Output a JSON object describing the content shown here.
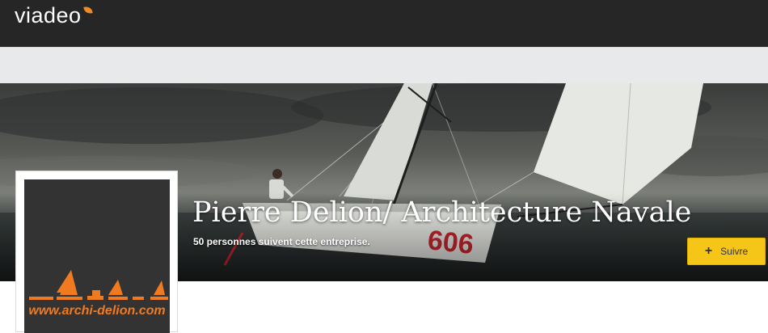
{
  "header": {
    "logo_text": "viadeo",
    "logo_accent_color": "#f08a24",
    "background_color": "#262626"
  },
  "cover": {
    "image_description_icon": "sailboat-photo",
    "sail_number": "606"
  },
  "company": {
    "name": "Pierre Delion/ Architecture Navale",
    "followers_text": "50 personnes suivent cette entreprise.",
    "logo_url_text": "www.archi-delion.com",
    "logo_accent_color": "#f07a20"
  },
  "actions": {
    "follow_icon": "plus-icon",
    "follow_label": "Suivre",
    "follow_color": "#f5c518"
  }
}
